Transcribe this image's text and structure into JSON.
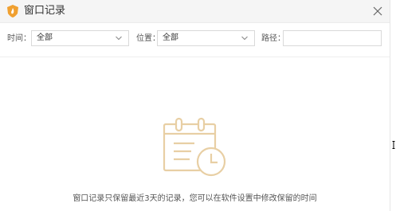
{
  "window": {
    "title": "窗口记录"
  },
  "filters": {
    "time_label": "时间：",
    "time_value": "全部",
    "position_label": "位置：",
    "position_value": "全部",
    "path_label": "路径：",
    "path_value": "",
    "path_placeholder": ""
  },
  "empty_state": {
    "message": "窗口记录只保留最近3天的记录，您可以在软件设置中修改保留的时间"
  },
  "colors": {
    "accent": "#f0a030",
    "icon_tint": "#e8cfa4",
    "titlebar_bg": "#f5f5f5"
  },
  "icons": {
    "logo": "shield-flame-logo",
    "close": "close-icon",
    "dropdown": "chevron-down-icon",
    "empty": "calendar-clock-icon"
  }
}
